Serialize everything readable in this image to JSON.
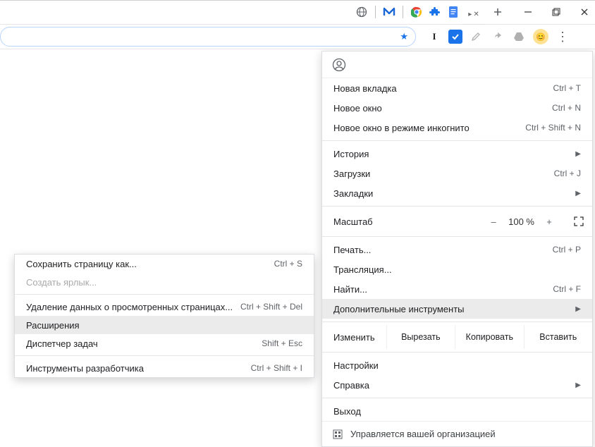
{
  "tabstrip": {
    "icons": [
      "globe",
      "malwarebytes",
      "chrome-colored",
      "puzzle",
      "docs"
    ],
    "new_tab": "+"
  },
  "wincontrols": {
    "min": "–",
    "max": "❐",
    "close": "✕"
  },
  "toolbar": {
    "star": "★",
    "ext_idev": "I",
    "ext_check": "✓",
    "ext_highlighter": "",
    "ext_sync": "",
    "ext_drive": "",
    "avatar": "😊",
    "kebab": "⋮"
  },
  "main_menu": {
    "profile_icon": "◯",
    "items1": [
      {
        "label": "Новая вкладка",
        "shortcut": "Ctrl + T"
      },
      {
        "label": "Новое окно",
        "shortcut": "Ctrl + N"
      },
      {
        "label": "Новое окно в режиме инкогнито",
        "shortcut": "Ctrl + Shift + N"
      }
    ],
    "items2": [
      {
        "label": "История",
        "arrow": true
      },
      {
        "label": "Загрузки",
        "shortcut": "Ctrl + J"
      },
      {
        "label": "Закладки",
        "arrow": true
      }
    ],
    "zoom": {
      "label": "Масштаб",
      "minus": "–",
      "value": "100 %",
      "plus": "+",
      "fullscreen": "⛶"
    },
    "items3": [
      {
        "label": "Печать...",
        "shortcut": "Ctrl + P"
      },
      {
        "label": "Трансляция..."
      },
      {
        "label": "Найти...",
        "shortcut": "Ctrl + F"
      },
      {
        "label": "Дополнительные инструменты",
        "arrow": true,
        "hl": true
      }
    ],
    "edit": {
      "label": "Изменить",
      "cut": "Вырезать",
      "copy": "Копировать",
      "paste": "Вставить"
    },
    "items4": [
      {
        "label": "Настройки"
      },
      {
        "label": "Справка",
        "arrow": true
      }
    ],
    "exit": {
      "label": "Выход"
    },
    "org": {
      "icon": "▦",
      "label": "Управляется вашей организацией"
    }
  },
  "sub_menu": {
    "items": [
      {
        "label": "Сохранить страницу как...",
        "shortcut": "Ctrl + S"
      },
      {
        "label": "Создать ярлык...",
        "disabled": true
      },
      {
        "sep": true
      },
      {
        "label": "Удаление данных о просмотренных страницах...",
        "shortcut": "Ctrl + Shift + Del"
      },
      {
        "label": "Расширения",
        "hl": true
      },
      {
        "label": "Диспетчер задач",
        "shortcut": "Shift + Esc"
      },
      {
        "sep": true
      },
      {
        "label": "Инструменты разработчика",
        "shortcut": "Ctrl + Shift + I"
      }
    ]
  }
}
